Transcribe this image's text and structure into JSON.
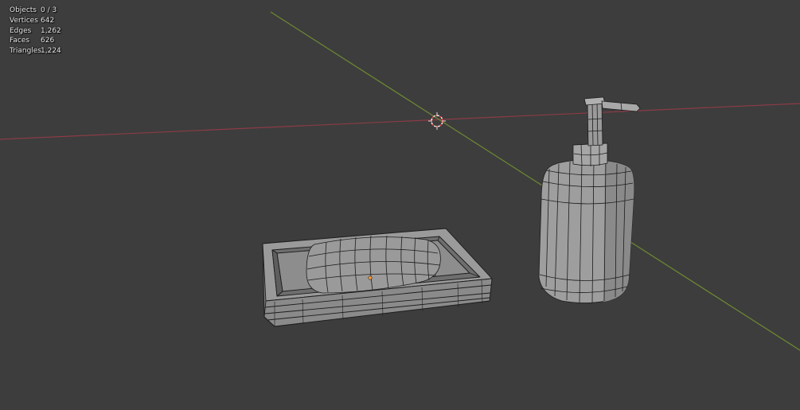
{
  "viewport": {
    "background": "#3d3d3d",
    "x_axis_color": "#8a3c46",
    "y_axis_color": "#6e8a32",
    "cursor_color": "#ff4d4d",
    "origin_color": "#ff9a2e"
  },
  "stats": [
    {
      "label": "Objects",
      "value": "0 / 3"
    },
    {
      "label": "Vertices",
      "value": "642"
    },
    {
      "label": "Edges",
      "value": "1,262"
    },
    {
      "label": "Faces",
      "value": "626"
    },
    {
      "label": "Triangles",
      "value": "1,224"
    }
  ],
  "objects": [
    "soap-dish",
    "soap-bar",
    "soap-dispenser"
  ]
}
